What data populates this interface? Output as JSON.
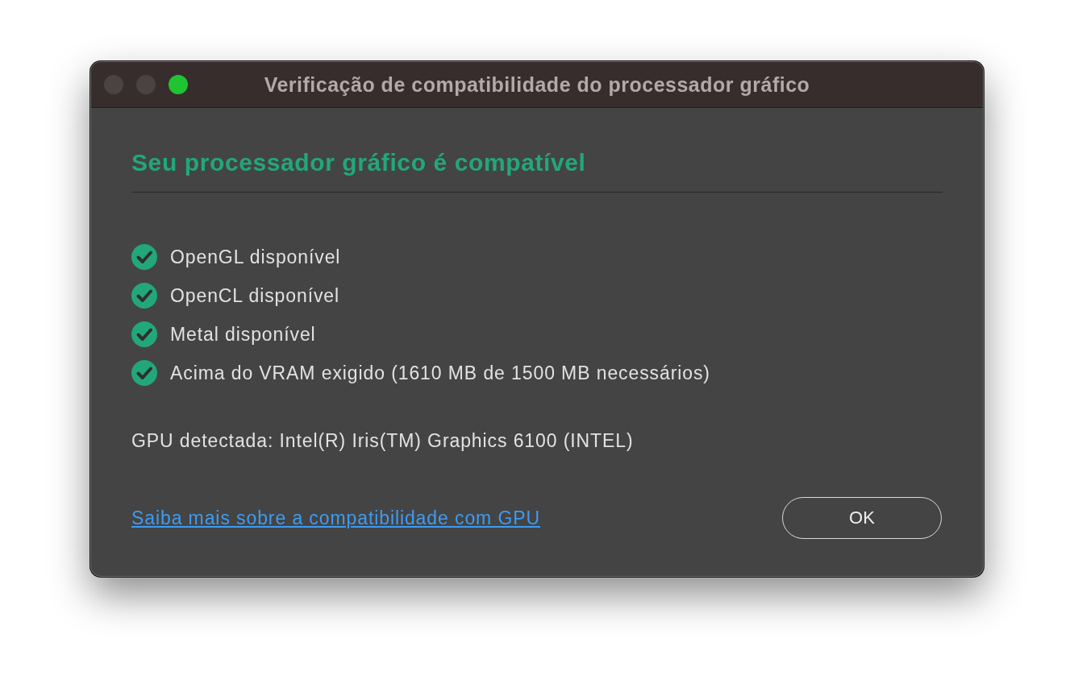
{
  "window": {
    "title": "Verificação de compatibilidade do processador gráfico",
    "controls": [
      {
        "color": "#4b4343"
      },
      {
        "color": "#4b4343"
      },
      {
        "color": "#1fc431"
      }
    ]
  },
  "heading": "Seu processador gráfico é compatível",
  "checks": [
    {
      "label": "OpenGL disponível",
      "passed": true
    },
    {
      "label": "OpenCL disponível",
      "passed": true
    },
    {
      "label": "Metal disponível",
      "passed": true
    },
    {
      "label": "Acima do VRAM exigido (1610 MB de 1500 MB necessários)",
      "passed": true
    }
  ],
  "gpu_info": "GPU detectada: Intel(R) Iris(TM) Graphics 6100 (INTEL)",
  "footer": {
    "link": "Saiba mais sobre a compatibilidade com GPU",
    "button": "OK"
  }
}
